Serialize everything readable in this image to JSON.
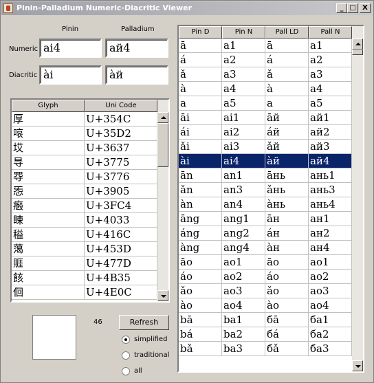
{
  "window": {
    "title": "Pinin-Palladium Numeric-Diacritic Viewer",
    "min_label": "_",
    "max_label": "□",
    "close_label": "X"
  },
  "form": {
    "col_pinin": "Pinin",
    "col_palladium": "Palladium",
    "numeric_label": "Numeric",
    "diacritic_label": "Diacritic",
    "numeric_pinin": "ai4",
    "numeric_palladium": "ай4",
    "diacritic_pinin": "ài",
    "diacritic_palladium": "àй"
  },
  "glyph_table": {
    "headers": [
      "Glyph",
      "Uni Code"
    ],
    "rows": [
      [
        "厚",
        "U+354C"
      ],
      [
        "㗒",
        "U+35D2"
      ],
      [
        "㘷",
        "U+3637"
      ],
      [
        "㝵",
        "U+3775"
      ],
      [
        "㝶",
        "U+3776"
      ],
      [
        "㤅",
        "U+3905"
      ],
      [
        "㿄",
        "U+3FC4"
      ],
      [
        "䀳",
        "U+4033"
      ],
      [
        "䅬",
        "U+416C"
      ],
      [
        "䔽",
        "U+453D"
      ],
      [
        "䝽",
        "U+477D"
      ],
      [
        "䬵",
        "U+4B35"
      ],
      [
        "佪",
        "U+4E0C"
      ]
    ]
  },
  "count": "46",
  "refresh_label": "Refresh",
  "radios": [
    {
      "label": "simplified",
      "checked": true
    },
    {
      "label": "traditional",
      "checked": false
    },
    {
      "label": "all",
      "checked": false
    }
  ],
  "syllable_table": {
    "headers": [
      "Pin D",
      "Pin N",
      "Pall LD",
      "Pall N"
    ],
    "selected_index": 8,
    "rows": [
      [
        "ā",
        "a1",
        "ā",
        "а1"
      ],
      [
        "á",
        "a2",
        "á",
        "а2"
      ],
      [
        "ǎ",
        "a3",
        "ǎ",
        "а3"
      ],
      [
        "à",
        "a4",
        "à",
        "а4"
      ],
      [
        "a",
        "a5",
        "а",
        "а5"
      ],
      [
        "āi",
        "ai1",
        "āй",
        "ай1"
      ],
      [
        "ái",
        "ai2",
        "áй",
        "ай2"
      ],
      [
        "ǎi",
        "ai3",
        "ǎй",
        "ай3"
      ],
      [
        "ài",
        "ai4",
        "àй",
        "ай4"
      ],
      [
        "ān",
        "an1",
        "āнь",
        "ань1"
      ],
      [
        "ǎn",
        "an3",
        "ǎнь",
        "ань3"
      ],
      [
        "àn",
        "an4",
        "àнь",
        "ань4"
      ],
      [
        "āng",
        "ang1",
        "āн",
        "ан1"
      ],
      [
        "áng",
        "ang2",
        "áн",
        "ан2"
      ],
      [
        "àng",
        "ang4",
        "àн",
        "ан4"
      ],
      [
        "āo",
        "ao1",
        "āо",
        "ао1"
      ],
      [
        "áo",
        "ao2",
        "áо",
        "ао2"
      ],
      [
        "ǎo",
        "ao3",
        "ǎо",
        "ао3"
      ],
      [
        "ào",
        "ao4",
        "àо",
        "ао4"
      ],
      [
        "bā",
        "ba1",
        "бā",
        "ба1"
      ],
      [
        "bá",
        "ba2",
        "бá",
        "ба2"
      ],
      [
        "bǎ",
        "ba3",
        "бǎ",
        "ба3"
      ]
    ]
  }
}
